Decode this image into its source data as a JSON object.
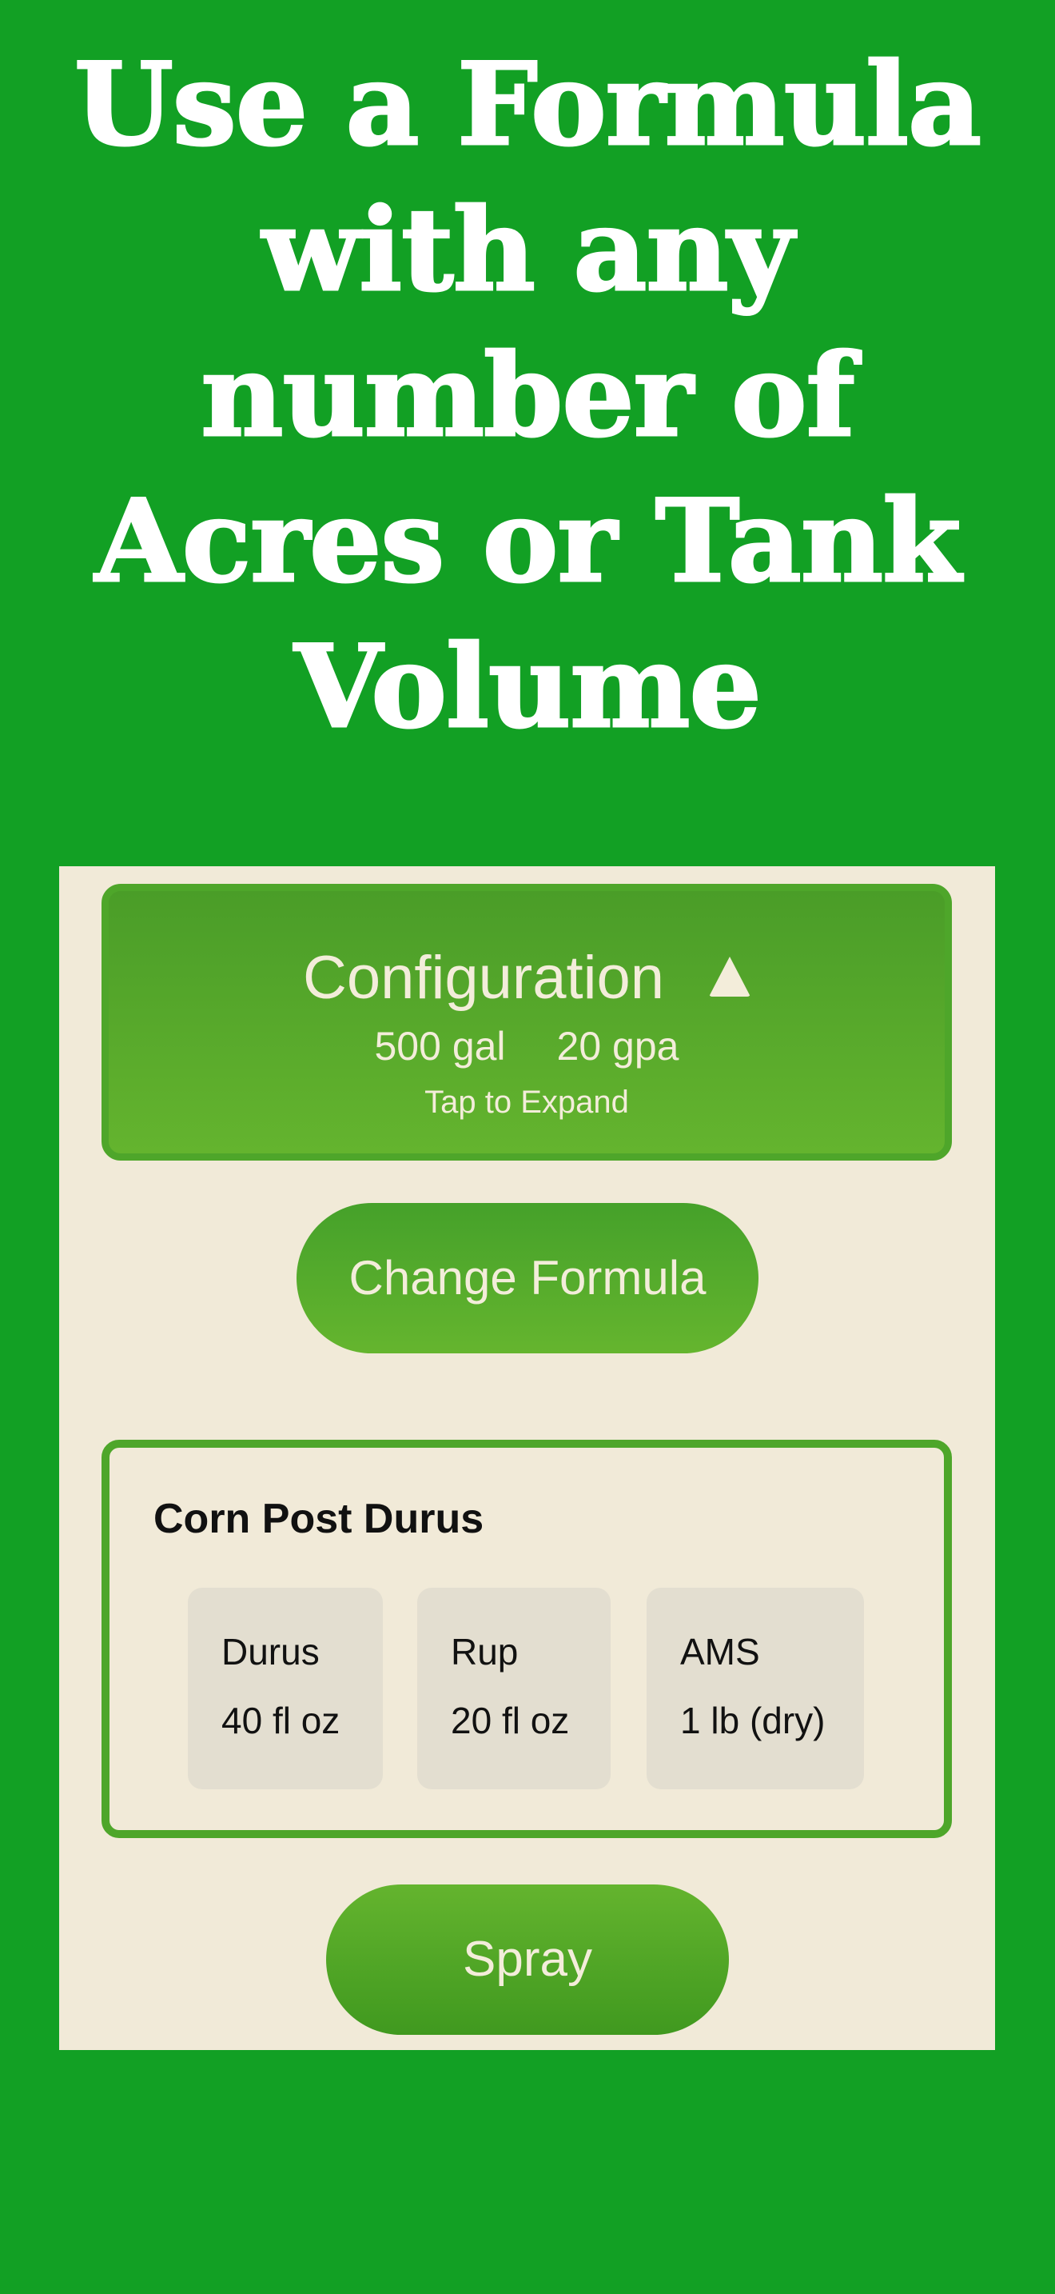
{
  "headline": "Use a Formula with any number of Acres or Tank Volume",
  "configuration": {
    "title": "Configuration",
    "icon": "triangle-up-icon",
    "tank_volume": "500 gal",
    "rate": "20 gpa",
    "hint": "Tap to Expand"
  },
  "change_formula_label": "Change Formula",
  "formula": {
    "name": "Corn Post Durus",
    "ingredients": [
      {
        "name": "Durus",
        "amount": "40 fl oz"
      },
      {
        "name": "Rup",
        "amount": "20 fl oz"
      },
      {
        "name": "AMS",
        "amount": "1 lb (dry)"
      }
    ]
  },
  "spray_label": "Spray",
  "colors": {
    "background": "#12a024",
    "screen": "#f1ead8",
    "accent": "#4ea62a",
    "chip": "#e3ded0",
    "light_text": "#f3edda"
  }
}
